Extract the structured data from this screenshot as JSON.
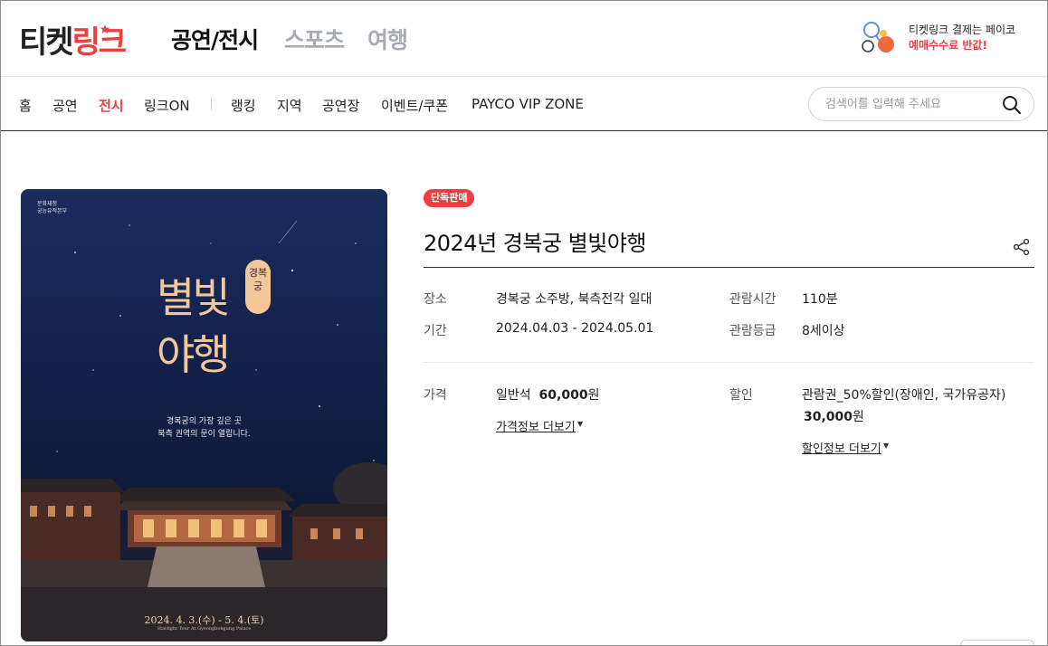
{
  "header": {
    "logo": {
      "part1": "티켓",
      "part2": "링크"
    },
    "categories": [
      "공연/전시",
      "스포츠",
      "여행"
    ],
    "promo": {
      "line1": "티켓링크 결제는 페이코",
      "line2": "예매수수료 반값!"
    }
  },
  "nav": {
    "items": [
      "홈",
      "공연",
      "전시",
      "링크ON",
      "랭킹",
      "지역",
      "공연장",
      "이벤트/쿠폰",
      "PAYCO VIP ZONE"
    ],
    "active": "전시",
    "search_placeholder": "검색어를 입력해 주세요"
  },
  "poster": {
    "org1": "문화재청",
    "org2": "궁능유적본부",
    "tag": "경복궁",
    "title_line1": "별빛",
    "title_line2": "야행",
    "sub_line1": "경복궁의 가장 깊은 곳",
    "sub_line2": "북측 권역의 문이 열립니다.",
    "date": "2024. 4. 3.(수) - 5. 4.(토)",
    "date_en": "Starlight Tour At Gyeongbokgung Palace"
  },
  "product": {
    "badge": "단독판매",
    "title": "2024년 경복궁 별빛야행",
    "info": {
      "place_label": "장소",
      "place": "경복궁 소주방, 북측전각 일대",
      "period_label": "기간",
      "period": "2024.04.03 - 2024.05.01",
      "runtime_label": "관람시간",
      "runtime": "110분",
      "rating_label": "관람등급",
      "rating": "8세이상"
    },
    "price": {
      "label": "가격",
      "seat": "일반석",
      "amount": "60,000",
      "unit": "원",
      "more": "가격정보 더보기"
    },
    "discount": {
      "label": "할인",
      "name": "관람권_50%할인(장애인, 국가유공자)",
      "amount": "30,000",
      "unit": "원",
      "more": "할인정보 더보기"
    }
  },
  "colors": {
    "accent": "#ef3e42",
    "inactive_category": "#a7abb3"
  }
}
